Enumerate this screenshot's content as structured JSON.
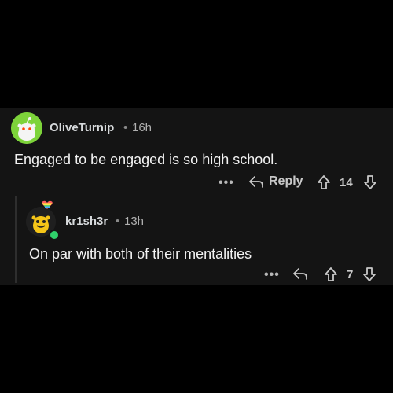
{
  "comments": [
    {
      "username": "OliveTurnip",
      "separator": "•",
      "time": "16h",
      "body": "Engaged to be engaged is so high school.",
      "more_label": "•••",
      "reply_label": "Reply",
      "votes": "14",
      "avatar_color": "#7dd33a"
    },
    {
      "username": "kr1sh3r",
      "separator": "•",
      "time": "13h",
      "body": "On par with both of their mentalities",
      "more_label": "•••",
      "votes": "7",
      "online_color": "#2fd06a"
    }
  ],
  "icons": {
    "reply": "reply-arrow-icon",
    "upvote": "upvote-arrow-icon",
    "downvote": "downvote-arrow-icon",
    "more": "more-options-icon"
  }
}
